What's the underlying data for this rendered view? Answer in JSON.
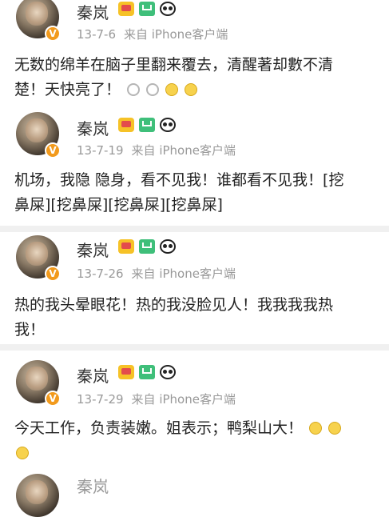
{
  "posts": [
    {
      "name": "秦岚",
      "date": "13-7-6",
      "source": "来自 iPhone客户端",
      "lines": [
        "无数的绵羊在脑子里翻来覆去，清醒著却數不清",
        "楚！天快亮了！"
      ],
      "emojis_line2": [
        "alarm-clock-icon",
        "alarm-clock-icon",
        "smile-emoji-icon",
        "smile-emoji-icon"
      ]
    },
    {
      "name": "秦岚",
      "date": "13-7-19",
      "source": "来自 iPhone客户端",
      "lines": [
        "机场，我隐 隐身，看不见我！谁都看不见我！[挖",
        "鼻屎][挖鼻屎][挖鼻屎][挖鼻屎]"
      ]
    },
    {
      "name": "秦岚",
      "date": "13-7-26",
      "source": "来自 iPhone客户端",
      "lines": [
        "热的我头晕眼花！热的我没脸见人！我我我我热",
        "我！"
      ]
    },
    {
      "name": "秦岚",
      "date": "13-7-29",
      "source": "来自 iPhone客户端",
      "lines": [
        "今天工作，负责装嫩。姐表示；鸭梨山大！",
        ""
      ],
      "emojis_line1": [
        "smile-emoji-icon",
        "smile-emoji-icon"
      ],
      "emojis_line2": [
        "money-emoji-icon"
      ]
    },
    {
      "name": "秦岚"
    }
  ],
  "verified_badge": "V",
  "colors": {
    "verified": "#f29a1c",
    "vip": "#3fbf7a",
    "crown": "#f6c227",
    "meta_text": "#999999",
    "divider": "#f0f0f0"
  }
}
